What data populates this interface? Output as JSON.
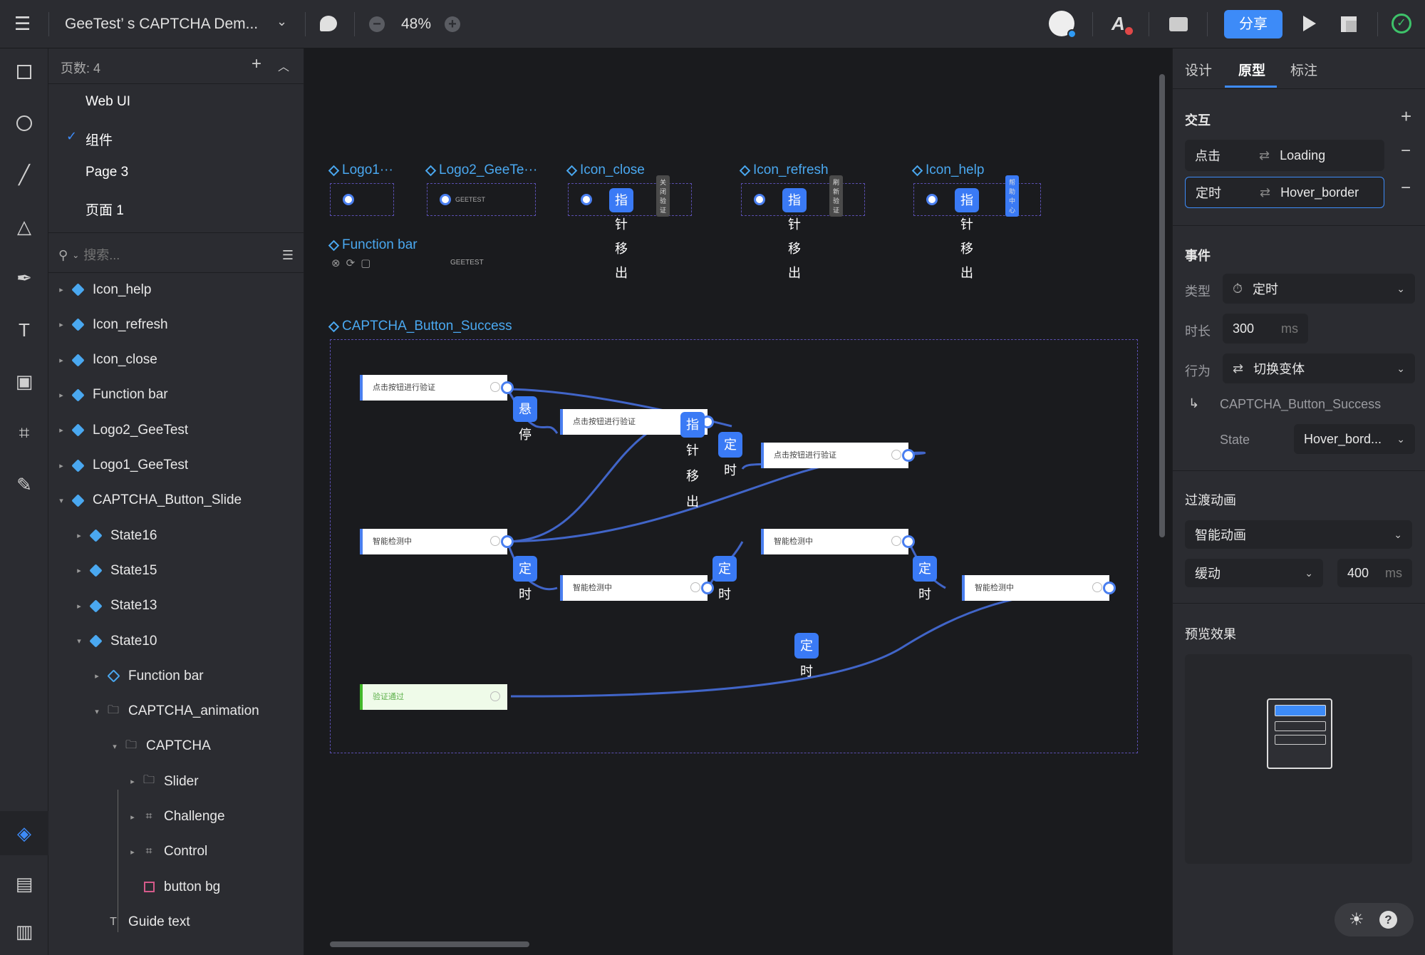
{
  "topbar": {
    "title": "GeeTest’ s CAPTCHA Dem...",
    "zoom": "48%",
    "share_label": "分享"
  },
  "pages": {
    "count_label": "页数: 4",
    "items": [
      {
        "label": "Web UI"
      },
      {
        "label": "组件",
        "selected": true
      },
      {
        "label": "Page 3"
      },
      {
        "label": "页面 1"
      }
    ]
  },
  "search": {
    "placeholder": "搜索..."
  },
  "tree": [
    {
      "label": "Icon_help",
      "icon": "component-icon"
    },
    {
      "label": "Icon_refresh",
      "icon": "component-icon"
    },
    {
      "label": "Icon_close",
      "icon": "component-icon"
    },
    {
      "label": "Function bar",
      "icon": "component-icon"
    },
    {
      "label": "Logo2_GeeTest",
      "icon": "component-icon"
    },
    {
      "label": "Logo1_GeeTest",
      "icon": "component-icon"
    },
    {
      "label": "CAPTCHA_Button_Slide",
      "icon": "component-icon"
    },
    {
      "label": "State16",
      "icon": "component-icon"
    },
    {
      "label": "State15",
      "icon": "component-icon"
    },
    {
      "label": "State13",
      "icon": "component-icon"
    },
    {
      "label": "State10",
      "icon": "component-icon"
    },
    {
      "label": "Function bar",
      "icon": "instance-icon"
    },
    {
      "label": "CAPTCHA_animation",
      "icon": "folder-icon"
    },
    {
      "label": "CAPTCHA",
      "icon": "folder-icon"
    },
    {
      "label": "Slider",
      "icon": "folder-icon"
    },
    {
      "label": "Challenge",
      "icon": "frame-icon"
    },
    {
      "label": "Control",
      "icon": "frame-icon"
    },
    {
      "label": "button bg",
      "icon": "rectangle-icon"
    },
    {
      "label": "Guide text",
      "icon": "text-icon"
    }
  ],
  "canvas": {
    "components": [
      {
        "label": "Logo1···"
      },
      {
        "label": "Logo2_GeeTe···",
        "logo_text": "GEETEST"
      },
      {
        "label": "Icon_close",
        "tooltip": "关闭验证",
        "badge": "指针移出"
      },
      {
        "label": "Icon_refresh",
        "tooltip": "刷新验证",
        "badge": "指针移出"
      },
      {
        "label": "Icon_help",
        "tooltip": "帮助中心",
        "badge": "指针移出"
      }
    ],
    "function_bar": {
      "label": "Function bar",
      "logo_text": "GEETEST"
    },
    "flow": {
      "label": "CAPTCHA_Button_Success",
      "nodes": [
        "点击按钮进行验证",
        "点击按钮进行验证",
        "点击按钮进行验证",
        "智能检测中",
        "智能检测中",
        "智能检测中",
        "智能检测中",
        "验证通过"
      ],
      "badges": [
        "悬停",
        "指针移出",
        "定时",
        "定时",
        "定时",
        "定时",
        "定时"
      ]
    }
  },
  "right": {
    "tabs": [
      {
        "label": "设计"
      },
      {
        "label": "原型",
        "active": true
      },
      {
        "label": "标注"
      }
    ],
    "interaction": {
      "title": "交互",
      "rows": [
        {
          "trigger": "点击",
          "target": "Loading"
        },
        {
          "trigger": "定时",
          "target": "Hover_border",
          "selected": true
        }
      ]
    },
    "event": {
      "title": "事件",
      "type_label": "类型",
      "type_value": "定时",
      "duration_label": "时长",
      "duration_value": "300",
      "duration_unit": "ms",
      "action_label": "行为",
      "action_value": "切换变体",
      "target": "CAPTCHA_Button_Success",
      "state_label": "State",
      "state_value": "Hover_bord..."
    },
    "transition": {
      "title": "过渡动画",
      "animation": "智能动画",
      "easing": "缓动",
      "duration": "400",
      "unit": "ms"
    },
    "preview": {
      "title": "预览效果"
    }
  },
  "colors": {
    "accent": "#3d8bf8",
    "canvas": "#1a1b1e",
    "panel": "#2b2c31",
    "component": "#4aa8f0",
    "badge": "#3a7af5"
  }
}
